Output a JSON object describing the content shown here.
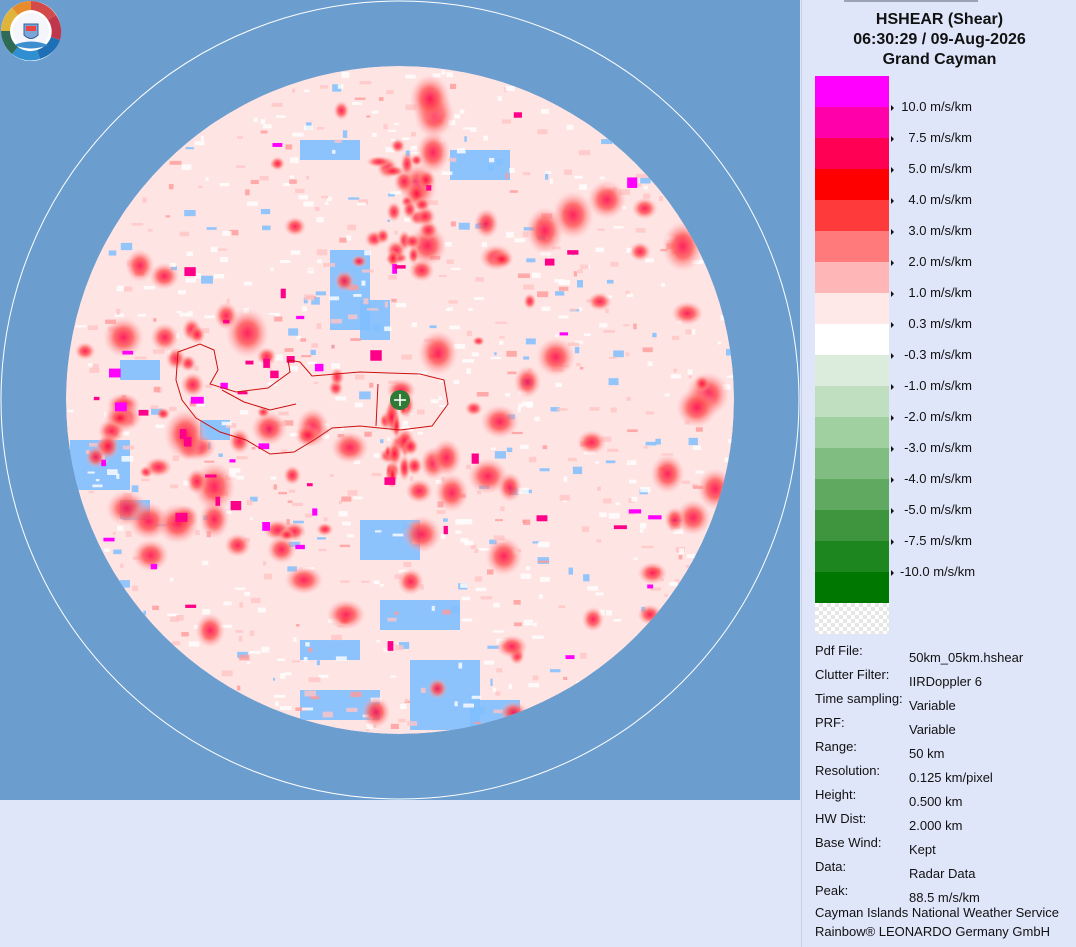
{
  "product": {
    "title": "HSHEAR (Shear)",
    "datetime": "06:30:29 / 09-Aug-2026",
    "site": "Grand Cayman"
  },
  "legend": [
    {
      "label": "10.0 m/s/km",
      "color": "#ff00ff"
    },
    {
      "label": "7.5 m/s/km",
      "color": "#ff00aa"
    },
    {
      "label": "5.0 m/s/km",
      "color": "#ff0055"
    },
    {
      "label": "4.0 m/s/km",
      "color": "#ff0000"
    },
    {
      "label": "3.0 m/s/km",
      "color": "#ff3a3a"
    },
    {
      "label": "2.0 m/s/km",
      "color": "#ff7a7a"
    },
    {
      "label": "1.0 m/s/km",
      "color": "#ffb6b6"
    },
    {
      "label": "0.3 m/s/km",
      "color": "#ffe8e8"
    },
    {
      "label": "-0.3 m/s/km",
      "color": "#ffffff"
    },
    {
      "label": "-1.0 m/s/km",
      "color": "#dcecdc"
    },
    {
      "label": "-2.0 m/s/km",
      "color": "#c0dfc0"
    },
    {
      "label": "-3.0 m/s/km",
      "color": "#a0cfa0"
    },
    {
      "label": "-4.0 m/s/km",
      "color": "#80bd80"
    },
    {
      "label": "-5.0 m/s/km",
      "color": "#60a960"
    },
    {
      "label": "-7.5 m/s/km",
      "color": "#3e953e"
    },
    {
      "label": "-10.0 m/s/km",
      "color": "#1e861e"
    },
    {
      "label": "",
      "color": "#007700"
    }
  ],
  "info": [
    {
      "key": "Pdf File:",
      "value": "50km_05km.hshear"
    },
    {
      "key": "Clutter Filter:",
      "value": "IIRDoppler 6"
    },
    {
      "key": "Time sampling:",
      "value": "Variable"
    },
    {
      "key": "PRF:",
      "value": "Variable"
    },
    {
      "key": "Range:",
      "value": "50 km"
    },
    {
      "key": "Resolution:",
      "value": "0.125 km/pixel"
    },
    {
      "key": "Height:",
      "value": "0.500 km"
    },
    {
      "key": "HW Dist:",
      "value": "2.000 km"
    },
    {
      "key": "Base Wind:",
      "value": "Kept"
    },
    {
      "key": "Data:",
      "value": "Radar Data"
    },
    {
      "key": "Peak:",
      "value": "88.5 m/s/km"
    }
  ],
  "footer": {
    "line1": "Cayman Islands National Weather Service",
    "line2": "Rainbow® LEONARDO Germany GmbH"
  },
  "colors": {
    "ocean": "#6b9ecf",
    "no_echo": "#80bfff",
    "panel_bg": "#e0e6fa",
    "coastline": "#cc1111",
    "radar_marker": "#2f7a35"
  }
}
